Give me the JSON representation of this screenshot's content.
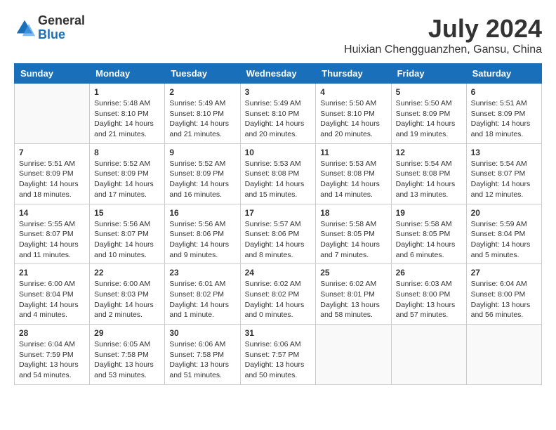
{
  "logo": {
    "general": "General",
    "blue": "Blue"
  },
  "title": "July 2024",
  "subtitle": "Huixian Chengguanzhen, Gansu, China",
  "days_of_week": [
    "Sunday",
    "Monday",
    "Tuesday",
    "Wednesday",
    "Thursday",
    "Friday",
    "Saturday"
  ],
  "weeks": [
    [
      {
        "day": "",
        "info": ""
      },
      {
        "day": "1",
        "info": "Sunrise: 5:48 AM\nSunset: 8:10 PM\nDaylight: 14 hours\nand 21 minutes."
      },
      {
        "day": "2",
        "info": "Sunrise: 5:49 AM\nSunset: 8:10 PM\nDaylight: 14 hours\nand 21 minutes."
      },
      {
        "day": "3",
        "info": "Sunrise: 5:49 AM\nSunset: 8:10 PM\nDaylight: 14 hours\nand 20 minutes."
      },
      {
        "day": "4",
        "info": "Sunrise: 5:50 AM\nSunset: 8:10 PM\nDaylight: 14 hours\nand 20 minutes."
      },
      {
        "day": "5",
        "info": "Sunrise: 5:50 AM\nSunset: 8:09 PM\nDaylight: 14 hours\nand 19 minutes."
      },
      {
        "day": "6",
        "info": "Sunrise: 5:51 AM\nSunset: 8:09 PM\nDaylight: 14 hours\nand 18 minutes."
      }
    ],
    [
      {
        "day": "7",
        "info": "Sunrise: 5:51 AM\nSunset: 8:09 PM\nDaylight: 14 hours\nand 18 minutes."
      },
      {
        "day": "8",
        "info": "Sunrise: 5:52 AM\nSunset: 8:09 PM\nDaylight: 14 hours\nand 17 minutes."
      },
      {
        "day": "9",
        "info": "Sunrise: 5:52 AM\nSunset: 8:09 PM\nDaylight: 14 hours\nand 16 minutes."
      },
      {
        "day": "10",
        "info": "Sunrise: 5:53 AM\nSunset: 8:08 PM\nDaylight: 14 hours\nand 15 minutes."
      },
      {
        "day": "11",
        "info": "Sunrise: 5:53 AM\nSunset: 8:08 PM\nDaylight: 14 hours\nand 14 minutes."
      },
      {
        "day": "12",
        "info": "Sunrise: 5:54 AM\nSunset: 8:08 PM\nDaylight: 14 hours\nand 13 minutes."
      },
      {
        "day": "13",
        "info": "Sunrise: 5:54 AM\nSunset: 8:07 PM\nDaylight: 14 hours\nand 12 minutes."
      }
    ],
    [
      {
        "day": "14",
        "info": "Sunrise: 5:55 AM\nSunset: 8:07 PM\nDaylight: 14 hours\nand 11 minutes."
      },
      {
        "day": "15",
        "info": "Sunrise: 5:56 AM\nSunset: 8:07 PM\nDaylight: 14 hours\nand 10 minutes."
      },
      {
        "day": "16",
        "info": "Sunrise: 5:56 AM\nSunset: 8:06 PM\nDaylight: 14 hours\nand 9 minutes."
      },
      {
        "day": "17",
        "info": "Sunrise: 5:57 AM\nSunset: 8:06 PM\nDaylight: 14 hours\nand 8 minutes."
      },
      {
        "day": "18",
        "info": "Sunrise: 5:58 AM\nSunset: 8:05 PM\nDaylight: 14 hours\nand 7 minutes."
      },
      {
        "day": "19",
        "info": "Sunrise: 5:58 AM\nSunset: 8:05 PM\nDaylight: 14 hours\nand 6 minutes."
      },
      {
        "day": "20",
        "info": "Sunrise: 5:59 AM\nSunset: 8:04 PM\nDaylight: 14 hours\nand 5 minutes."
      }
    ],
    [
      {
        "day": "21",
        "info": "Sunrise: 6:00 AM\nSunset: 8:04 PM\nDaylight: 14 hours\nand 4 minutes."
      },
      {
        "day": "22",
        "info": "Sunrise: 6:00 AM\nSunset: 8:03 PM\nDaylight: 14 hours\nand 2 minutes."
      },
      {
        "day": "23",
        "info": "Sunrise: 6:01 AM\nSunset: 8:02 PM\nDaylight: 14 hours\nand 1 minute."
      },
      {
        "day": "24",
        "info": "Sunrise: 6:02 AM\nSunset: 8:02 PM\nDaylight: 14 hours\nand 0 minutes."
      },
      {
        "day": "25",
        "info": "Sunrise: 6:02 AM\nSunset: 8:01 PM\nDaylight: 13 hours\nand 58 minutes."
      },
      {
        "day": "26",
        "info": "Sunrise: 6:03 AM\nSunset: 8:00 PM\nDaylight: 13 hours\nand 57 minutes."
      },
      {
        "day": "27",
        "info": "Sunrise: 6:04 AM\nSunset: 8:00 PM\nDaylight: 13 hours\nand 56 minutes."
      }
    ],
    [
      {
        "day": "28",
        "info": "Sunrise: 6:04 AM\nSunset: 7:59 PM\nDaylight: 13 hours\nand 54 minutes."
      },
      {
        "day": "29",
        "info": "Sunrise: 6:05 AM\nSunset: 7:58 PM\nDaylight: 13 hours\nand 53 minutes."
      },
      {
        "day": "30",
        "info": "Sunrise: 6:06 AM\nSunset: 7:58 PM\nDaylight: 13 hours\nand 51 minutes."
      },
      {
        "day": "31",
        "info": "Sunrise: 6:06 AM\nSunset: 7:57 PM\nDaylight: 13 hours\nand 50 minutes."
      },
      {
        "day": "",
        "info": ""
      },
      {
        "day": "",
        "info": ""
      },
      {
        "day": "",
        "info": ""
      }
    ]
  ]
}
